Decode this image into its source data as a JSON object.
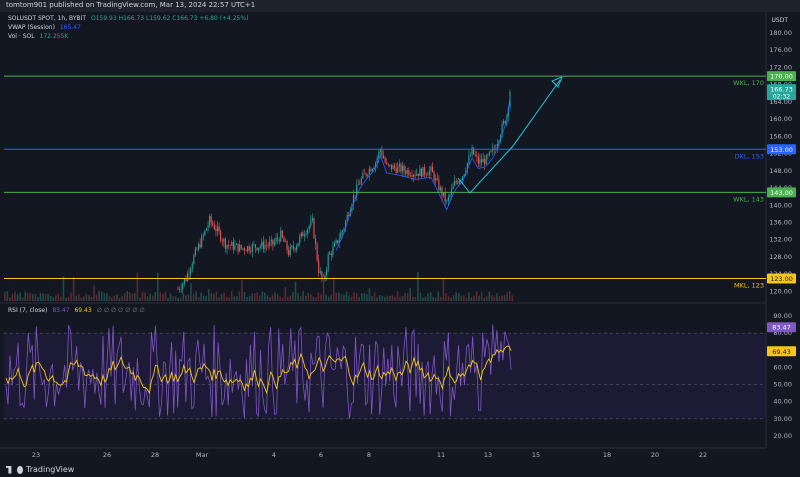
{
  "header": {
    "publisher": "tomtom901 published on TradingView.com, Mar 13, 2024 22:57 UTC+1"
  },
  "legend": {
    "symbol": "SOLUSDT SPOT, 1h, BYBIT",
    "ohlc": "O159.93 H166.73 L159.62 C166.73 +6.80 (+4.25%)",
    "vwap_label": "VWAP (Session)",
    "vwap_value": "165.47",
    "vol_label": "Vol · SOL",
    "vol_value": "172.255K",
    "rsi_label": "RSI (7, close)",
    "rsi_value1": "83.47",
    "rsi_value2": "69.43",
    "rsi_extra": "∅ ∅ ∅ ∅ ∅ ∅ ∅"
  },
  "price_axis": {
    "currency": "USDT",
    "ticks": [
      "180.00",
      "176.00",
      "172.00",
      "168.00",
      "164.00",
      "160.00",
      "156.00",
      "152.00",
      "148.00",
      "144.00",
      "140.00",
      "136.00",
      "132.00",
      "128.00",
      "124.00",
      "120.00"
    ],
    "current_price": "166.73",
    "countdown": "02:32"
  },
  "levels": [
    {
      "label": "WKL, 170",
      "badge": "170.00",
      "price": 170,
      "color": "#4caf50"
    },
    {
      "label": "DKL, 153",
      "badge": "153.00",
      "price": 153,
      "color": "#2962ff"
    },
    {
      "label": "WKL, 143",
      "badge": "143.00",
      "price": 143,
      "color": "#4caf50"
    },
    {
      "label": "MKL, 123",
      "badge": "123.00",
      "price": 123,
      "color": "#f5c518"
    }
  ],
  "rsi_axis": {
    "ticks": [
      "90.00",
      "80.00",
      "70.00",
      "60.00",
      "50.00",
      "40.00",
      "30.00",
      "20.00"
    ]
  },
  "time_axis": {
    "ticks": [
      "23",
      "26",
      "28",
      "Mar",
      "4",
      "6",
      "8",
      "11",
      "13",
      "15",
      "18",
      "20",
      "22"
    ]
  },
  "footer": {
    "brand": "TradingView"
  },
  "colors": {
    "background": "#131722",
    "up": "#26a69a",
    "down": "#ef5350",
    "rsi_line": "#7e57c2",
    "rsi_ma": "#f5c518",
    "arrow": "#26c6da"
  }
}
